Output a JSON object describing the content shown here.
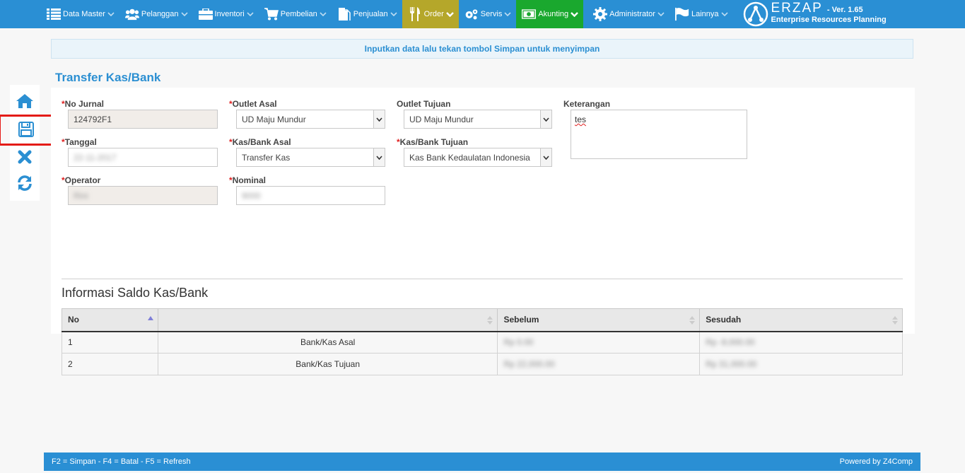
{
  "nav": {
    "items": [
      {
        "label": "Data Master",
        "icon": "list-icon"
      },
      {
        "label": "Pelanggan",
        "icon": "users-icon"
      },
      {
        "label": "Inventori",
        "icon": "briefcase-icon"
      },
      {
        "label": "Pembelian",
        "icon": "cart-icon"
      },
      {
        "label": "Penjualan",
        "icon": "document-icon"
      },
      {
        "label": "Order",
        "icon": "cutlery-icon"
      },
      {
        "label": "Servis",
        "icon": "gears-icon"
      },
      {
        "label": "Akunting",
        "icon": "money-icon"
      },
      {
        "label": "Administrator",
        "icon": "gear-icon"
      },
      {
        "label": "Lainnya",
        "icon": "flag-icon"
      }
    ],
    "brand_name": "ERZAP",
    "version": "- Ver. 1.65",
    "tagline": "Enterprise Resources Planning",
    "colors": {
      "bar": "#2a8fd4",
      "order": "#b5a72a",
      "akunting": "#1aa82e"
    }
  },
  "toolbar": {
    "buttons": [
      {
        "name": "home",
        "icon": "home-icon"
      },
      {
        "name": "save",
        "icon": "floppy-icon"
      },
      {
        "name": "cancel",
        "icon": "close-icon"
      },
      {
        "name": "refresh",
        "icon": "refresh-icon"
      }
    ]
  },
  "notice": "Inputkan data lalu tekan tombol Simpan untuk menyimpan",
  "page_title": "Transfer Kas/Bank",
  "form": {
    "no_jurnal": {
      "label": "No Jurnal",
      "value": "124792F1"
    },
    "tanggal": {
      "label": "Tanggal",
      "value": "22-11-2017"
    },
    "operator": {
      "label": "Operator",
      "value": "Rini"
    },
    "outlet_asal": {
      "label": "Outlet Asal",
      "value": "UD Maju Mundur"
    },
    "kas_bank_asal": {
      "label": "Kas/Bank Asal",
      "value": "Transfer Kas"
    },
    "nominal": {
      "label": "Nominal",
      "value": "9000"
    },
    "outlet_tujuan": {
      "label": "Outlet Tujuan",
      "value": "UD Maju Mundur"
    },
    "kas_bank_tujuan": {
      "label": "Kas/Bank Tujuan",
      "value": "Kas Bank Kedaulatan Indonesia"
    },
    "keterangan": {
      "label": "Keterangan",
      "value": "tes"
    },
    "required_mark": "*"
  },
  "saldo": {
    "title": "Informasi Saldo Kas/Bank",
    "columns": [
      "No",
      "",
      "Sebelum",
      "Sesudah"
    ],
    "rows": [
      {
        "no": "1",
        "name": "Bank/Kas Asal",
        "sebelum": "Rp 0.00",
        "sesudah": "Rp -9,000.00"
      },
      {
        "no": "2",
        "name": "Bank/Kas Tujuan",
        "sebelum": "Rp 22,000.00",
        "sesudah": "Rp 31,000.00"
      }
    ]
  },
  "footer": {
    "shortcuts": "F2 = Simpan - F4 = Batal - F5 = Refresh",
    "powered": "Powered by Z4Comp"
  }
}
